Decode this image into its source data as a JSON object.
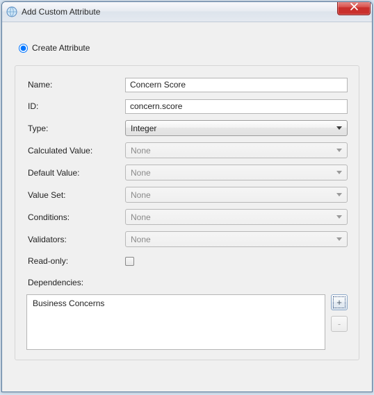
{
  "window": {
    "title": "Add Custom Attribute"
  },
  "mode": {
    "create_label": "Create Attribute"
  },
  "form": {
    "name": {
      "label": "Name:",
      "value": "Concern Score"
    },
    "id": {
      "label": "ID:",
      "value": "concern.score"
    },
    "type": {
      "label": "Type:",
      "value": "Integer"
    },
    "calculated_value": {
      "label": "Calculated Value:",
      "value": "None"
    },
    "default_value": {
      "label": "Default Value:",
      "value": "None"
    },
    "value_set": {
      "label": "Value Set:",
      "value": "None"
    },
    "conditions": {
      "label": "Conditions:",
      "value": "None"
    },
    "validators": {
      "label": "Validators:",
      "value": "None"
    },
    "readonly": {
      "label": "Read-only:",
      "checked": false
    },
    "dependencies": {
      "label": "Dependencies:",
      "items": [
        "Business Concerns"
      ],
      "add_label": "+",
      "remove_label": "-"
    }
  }
}
